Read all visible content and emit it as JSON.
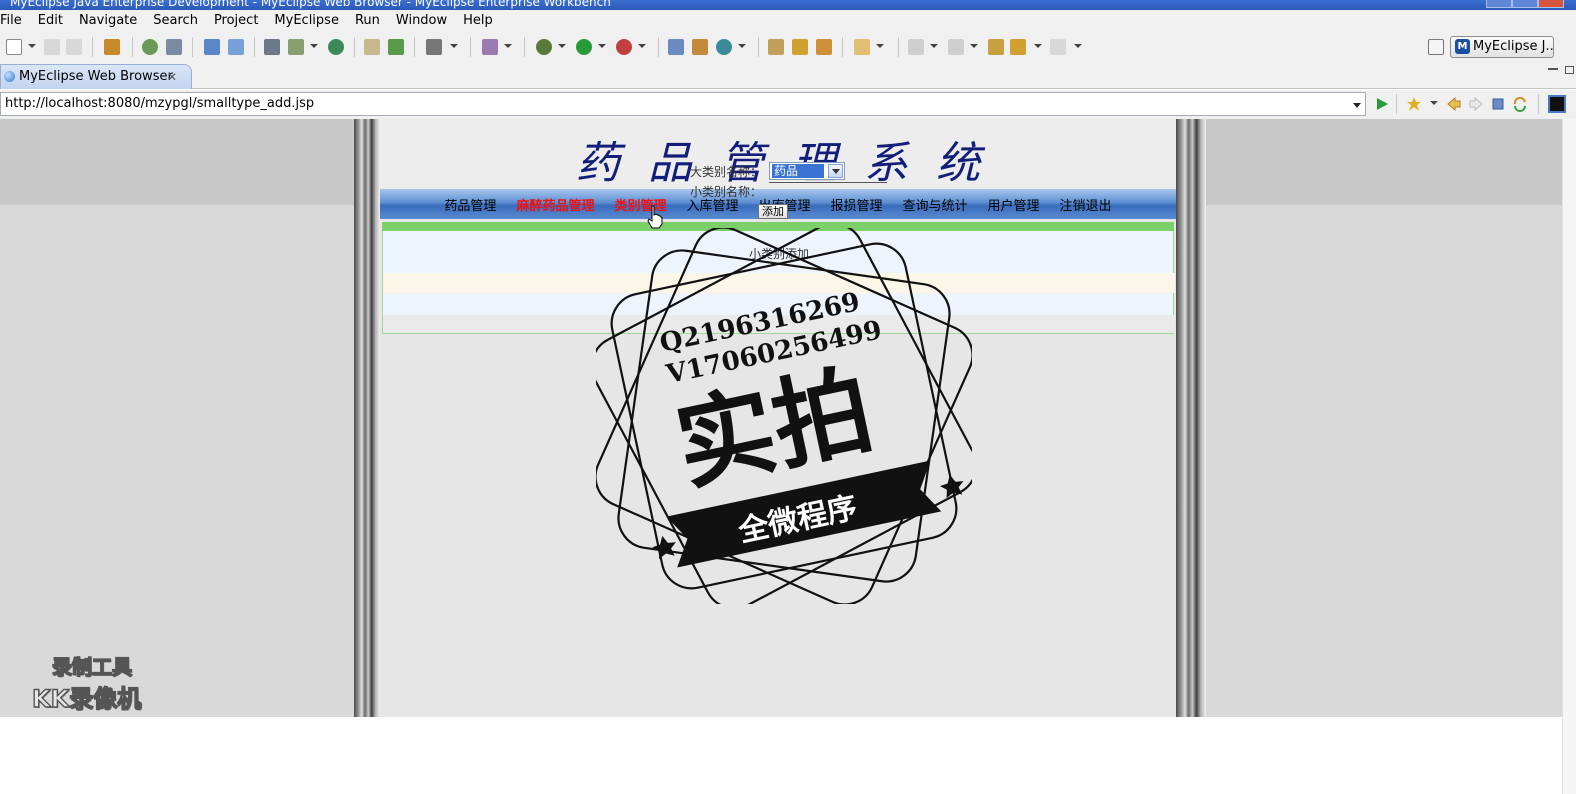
{
  "window": {
    "title": "MyEclipse Java Enterprise Development - MyEclipse Web Browser - MyEclipse Enterprise Workbench"
  },
  "menubar": {
    "items": [
      "File",
      "Edit",
      "Navigate",
      "Search",
      "Project",
      "MyEclipse",
      "Run",
      "Window",
      "Help"
    ]
  },
  "toolbar": {
    "perspective_label": "MyEclipse J...",
    "perspective_icon": "M"
  },
  "editor": {
    "tab_label": "MyEclipse Web Browser",
    "tab_close": "✕"
  },
  "browser": {
    "url": "http://localhost:8080/mzypgl/smalltype_add.jsp"
  },
  "site": {
    "title": "药品管理系统",
    "nav": [
      {
        "label": "药品管理",
        "active": false
      },
      {
        "label": "麻醉药品管理",
        "active": true
      },
      {
        "label": "类别管理",
        "active": true
      },
      {
        "label": "入库管理",
        "active": false
      },
      {
        "label": "出库管理",
        "active": false
      },
      {
        "label": "报损管理",
        "active": false
      },
      {
        "label": "查询与统计",
        "active": false
      },
      {
        "label": "用户管理",
        "active": false
      },
      {
        "label": "注销退出",
        "active": false
      }
    ],
    "form": {
      "title": "小类别添加",
      "big_label": "大类别名称：",
      "big_selected": "药品",
      "small_label": "小类别名称：",
      "small_value": "",
      "submit_label": "添加"
    }
  },
  "watermark": {
    "line1": "Q2196316269",
    "line2": "V17060256499",
    "big_text": "实拍",
    "ribbon_text": "全微程序",
    "recorder_line1": "录制工具",
    "recorder_line2": "KK录像机"
  },
  "colors": {
    "site_title": "#121e7a",
    "nav_active": "#ee1111",
    "nav_bar": "#3a6cbd",
    "green_bar": "#7bd06a"
  }
}
